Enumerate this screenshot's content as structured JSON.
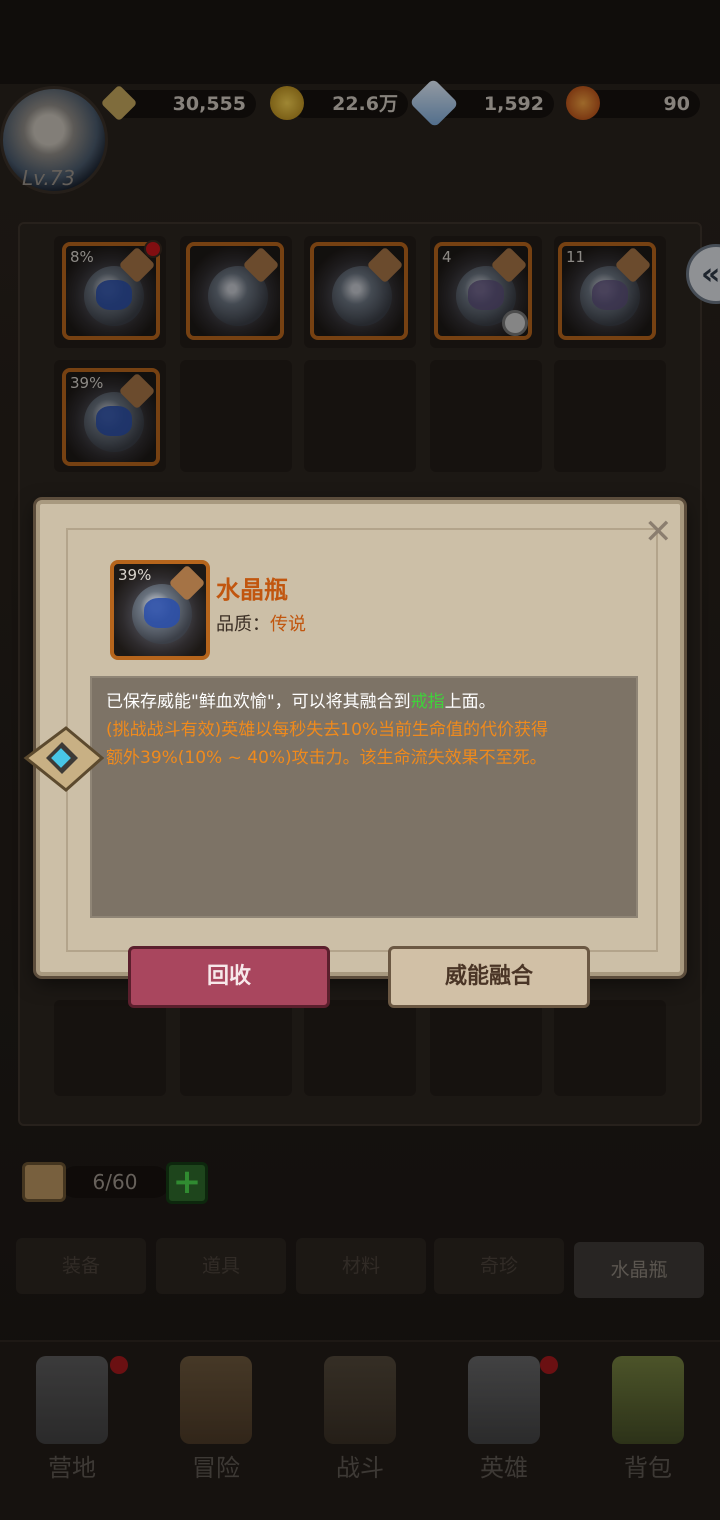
{
  "header": {
    "level": "Lv.73",
    "power": "30,555",
    "gold": "22.6万",
    "diamonds": "1,592",
    "stamina": "90"
  },
  "inventory": {
    "items": [
      {
        "pct": "8%",
        "rune": "blue",
        "badge": "red-dot"
      },
      {
        "pct": "",
        "rune": "none",
        "badge": ""
      },
      {
        "pct": "",
        "rune": "none",
        "badge": ""
      },
      {
        "pct": "4",
        "rune": "purple",
        "badge": "lock"
      },
      {
        "pct": "11",
        "rune": "purple",
        "badge": ""
      },
      {
        "pct": "39%",
        "rune": "blue",
        "badge": ""
      }
    ],
    "bag_count": "6/60"
  },
  "dialog": {
    "item_pct": "39%",
    "item_name": "水晶瓶",
    "quality_label": "品质：",
    "quality_value": "传说",
    "line1_a": "已保存威能\"鲜血欢愉\"，可以将其融合到",
    "line1_green": "戒指",
    "line1_b": "上面。",
    "line2": "(挑战战斗有效)英雄以每秒失去10%当前生命值的代价获得",
    "line3": "额外39%(10% ~ 40%)攻击力。该生命流失效果不至死。",
    "recycle_label": "回收",
    "fuse_label": "威能融合",
    "close_label": "✕"
  },
  "tabs": [
    "装备",
    "道具",
    "材料",
    "奇珍",
    "水晶瓶"
  ],
  "nav": [
    "营地",
    "冒险",
    "战斗",
    "英雄",
    "背包"
  ],
  "colors": {
    "accent_orange": "#c1560f",
    "highlight_green": "#3fd23a",
    "recycle_button": "#a9465e"
  }
}
